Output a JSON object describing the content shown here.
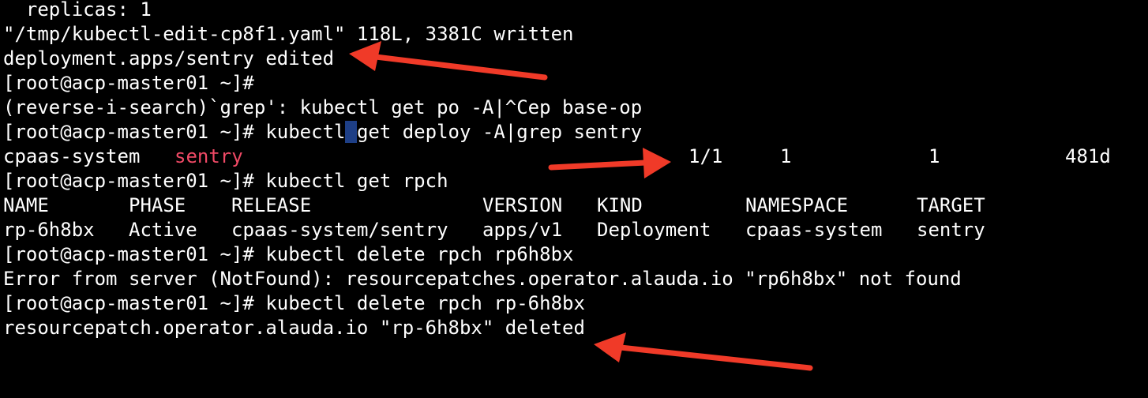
{
  "terminal": {
    "lines": [
      "  replicas: 1",
      "\"/tmp/kubectl-edit-cp8f1.yaml\" 118L, 3381C written",
      "deployment.apps/sentry edited",
      "[root@acp-master01 ~]#",
      "(reverse-i-search)`grep': kubectl get po -A|^Cep base-op"
    ],
    "cmd_get_deploy": {
      "before_cursor": "[root@acp-master01 ~]# kubectl",
      "cursor_char": " ",
      "after_cursor": "get deploy -A|grep sentry"
    },
    "deploy_row": {
      "namespace": "cpaas-system",
      "name": "sentry",
      "ready": "1/1",
      "up_to_date": "1",
      "available": "1",
      "age": "481d"
    },
    "cmd_get_rpch": "[root@acp-master01 ~]# kubectl get rpch",
    "rpch_table": {
      "headers": [
        "NAME",
        "PHASE",
        "RELEASE",
        "VERSION",
        "KIND",
        "NAMESPACE",
        "TARGET"
      ],
      "row": [
        "rp-6h8bx",
        "Active",
        "cpaas-system/sentry",
        "apps/v1",
        "Deployment",
        "cpaas-system",
        "sentry"
      ]
    },
    "tail_lines": [
      "[root@acp-master01 ~]# kubectl delete rpch rp6h8bx",
      "Error from server (NotFound): resourcepatches.operator.alauda.io \"rp6h8bx\" not found",
      "[root@acp-master01 ~]# kubectl delete rpch rp-6h8bx",
      "resourcepatch.operator.alauda.io \"rp-6h8bx\" deleted"
    ]
  },
  "colors": {
    "background": "#000000",
    "text": "#ffffff",
    "highlight": "#f04a66",
    "cursor": "#1e3f86",
    "arrow": "#f03a28"
  },
  "annotations": {
    "arrow_count": 3
  }
}
